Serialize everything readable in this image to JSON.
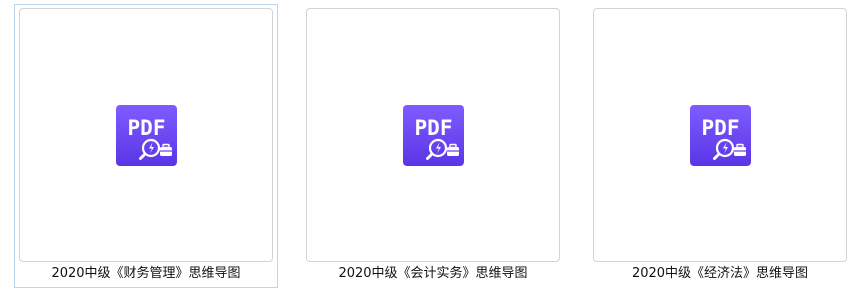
{
  "files": [
    {
      "name": "2020中级《财务管理》思维导图",
      "type_label": "PDF",
      "selected": true,
      "icon": "pdf-file-icon"
    },
    {
      "name": "2020中级《会计实务》思维导图",
      "type_label": "PDF",
      "selected": false,
      "icon": "pdf-file-icon"
    },
    {
      "name": "2020中级《经济法》思维导图",
      "type_label": "PDF",
      "selected": false,
      "icon": "pdf-file-icon"
    }
  ],
  "colors": {
    "icon_gradient_top": "#7f5cff",
    "icon_gradient_bottom": "#5b35e6",
    "selection_border": "#b9d7f0",
    "thumb_border": "#d3d3d3"
  }
}
